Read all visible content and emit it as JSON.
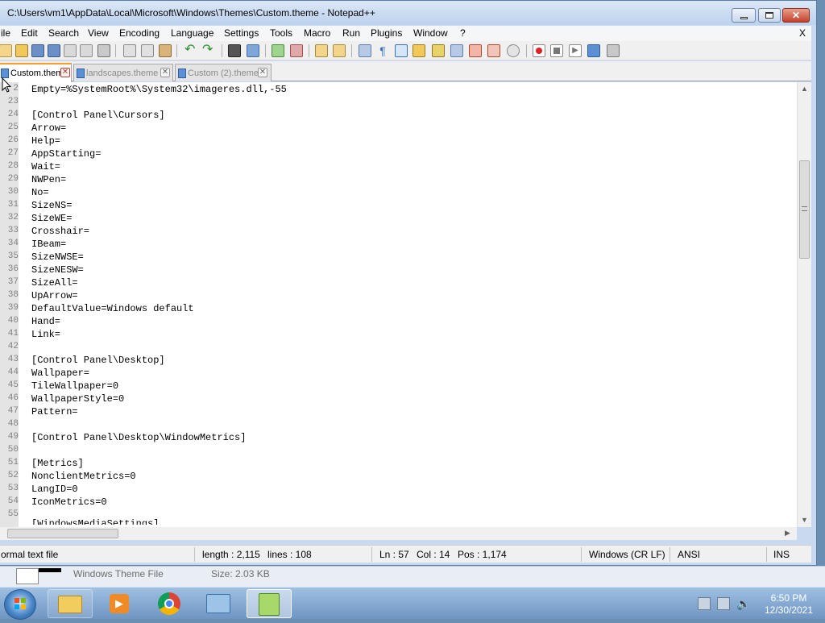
{
  "window": {
    "title": "C:\\Users\\vm1\\AppData\\Local\\Microsoft\\Windows\\Themes\\Custom.theme - Notepad++",
    "close_x": "X"
  },
  "menu": [
    "ile",
    "Edit",
    "Search",
    "View",
    "Encoding",
    "Language",
    "Settings",
    "Tools",
    "Macro",
    "Run",
    "Plugins",
    "Window",
    "?"
  ],
  "tabs": [
    {
      "label": "Custom.theme",
      "active": true
    },
    {
      "label": "landscapes.theme",
      "active": false
    },
    {
      "label": "Custom (2).theme",
      "active": false
    }
  ],
  "editor": {
    "lines": [
      {
        "num": "2",
        "text": "Empty=%SystemRoot%\\System32\\imageres.dll,-55"
      },
      {
        "num": "23",
        "text": ""
      },
      {
        "num": "24",
        "text": "[Control Panel\\Cursors]"
      },
      {
        "num": "25",
        "text": "Arrow="
      },
      {
        "num": "26",
        "text": "Help="
      },
      {
        "num": "27",
        "text": "AppStarting="
      },
      {
        "num": "28",
        "text": "Wait="
      },
      {
        "num": "29",
        "text": "NWPen="
      },
      {
        "num": "30",
        "text": "No="
      },
      {
        "num": "31",
        "text": "SizeNS="
      },
      {
        "num": "32",
        "text": "SizeWE="
      },
      {
        "num": "33",
        "text": "Crosshair="
      },
      {
        "num": "34",
        "text": "IBeam="
      },
      {
        "num": "35",
        "text": "SizeNWSE="
      },
      {
        "num": "36",
        "text": "SizeNESW="
      },
      {
        "num": "37",
        "text": "SizeAll="
      },
      {
        "num": "38",
        "text": "UpArrow="
      },
      {
        "num": "39",
        "text": "DefaultValue=Windows default"
      },
      {
        "num": "40",
        "text": "Hand="
      },
      {
        "num": "41",
        "text": "Link="
      },
      {
        "num": "42",
        "text": ""
      },
      {
        "num": "43",
        "text": "[Control Panel\\Desktop]"
      },
      {
        "num": "44",
        "text": "Wallpaper="
      },
      {
        "num": "45",
        "text": "TileWallpaper=0"
      },
      {
        "num": "46",
        "text": "WallpaperStyle=0"
      },
      {
        "num": "47",
        "text": "Pattern="
      },
      {
        "num": "48",
        "text": ""
      },
      {
        "num": "49",
        "text": "[Control Panel\\Desktop\\WindowMetrics]"
      },
      {
        "num": "50",
        "text": ""
      },
      {
        "num": "51",
        "text": "[Metrics]"
      },
      {
        "num": "52",
        "text": "NonclientMetrics=0"
      },
      {
        "num": "53",
        "text": "LangID=0"
      },
      {
        "num": "54",
        "text": "IconMetrics=0"
      },
      {
        "num": "55",
        "text": ""
      }
    ]
  },
  "status": {
    "file_type": "ormal text file",
    "length": "length : 2,115",
    "lines": "lines : 108",
    "ln": "Ln : 57",
    "col": "Col : 14",
    "pos": "Pos : 1,174",
    "eol": "Windows (CR LF)",
    "encoding": "ANSI",
    "mode": "INS"
  },
  "explorer": {
    "file_type": "Windows Theme File",
    "file_size": "Size: 2.03 KB"
  },
  "taskbar": {
    "time": "6:50 PM",
    "date": "12/30/2021"
  },
  "colors": {
    "tab_accent": "#f59e2a",
    "gutter": "#e4e4e4",
    "taskbar": "#6f95c2"
  }
}
